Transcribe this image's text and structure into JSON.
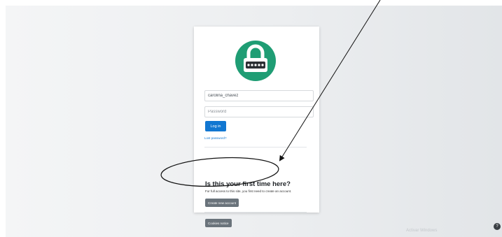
{
  "login": {
    "username_value": "carolina_chavez",
    "password_placeholder": "Password",
    "login_button": "Log in",
    "lost_password": "Lost password?"
  },
  "signup": {
    "heading": "Is this your first time here?",
    "description": "For full access to this site, you first need to create an account.",
    "create_account_button": "Create new account"
  },
  "footer": {
    "cookies_button": "Cookies notice"
  },
  "watermark": {
    "text": "Activar Windows"
  },
  "help": {
    "label": "?"
  },
  "colors": {
    "primary": "#1177d1",
    "logo": "#1f9d74",
    "secondary": "#6a737b"
  },
  "icons": {
    "logo": "lock-icon"
  }
}
